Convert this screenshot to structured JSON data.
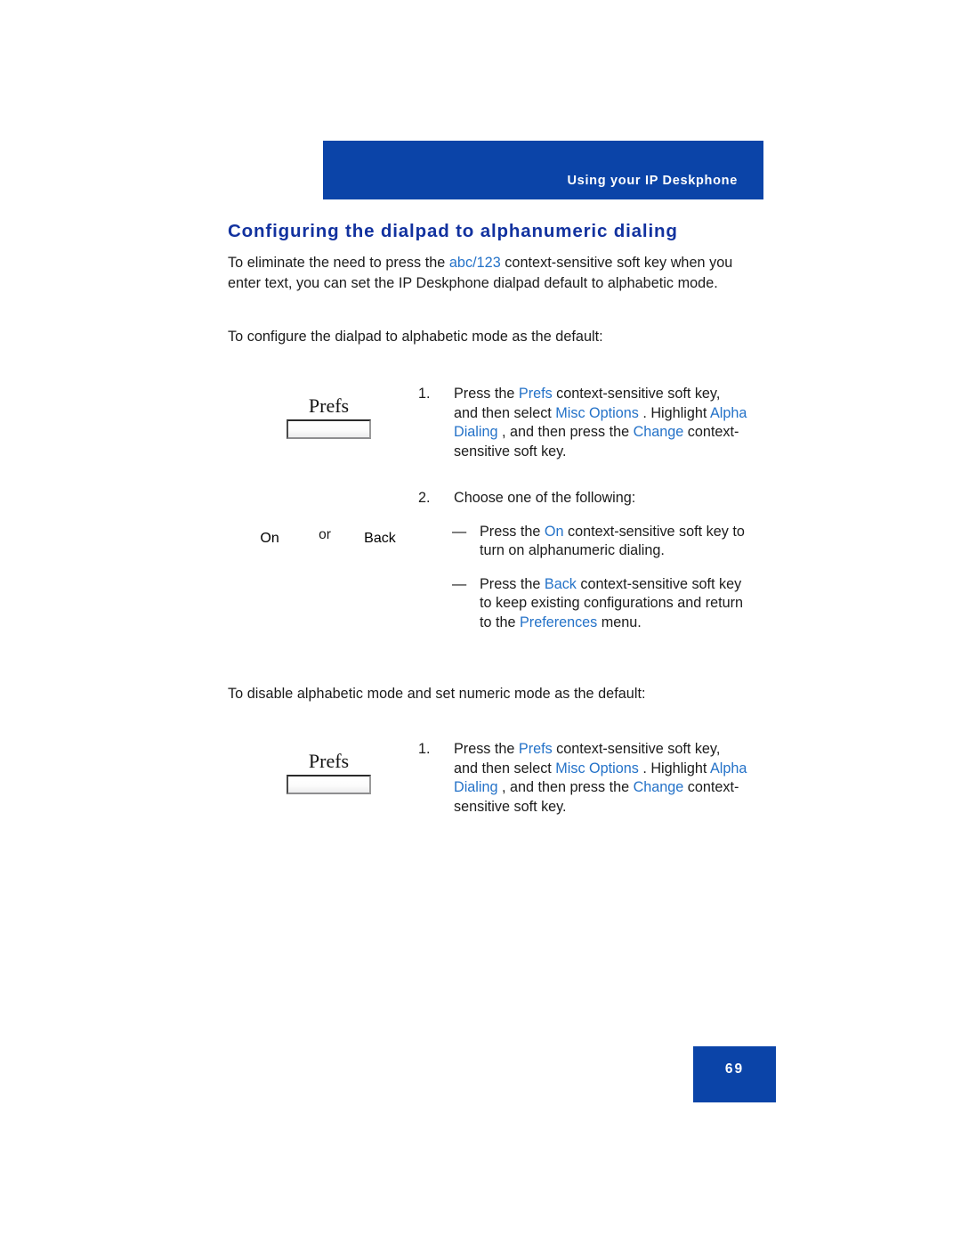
{
  "header": {
    "running_title": "Using your IP Deskphone"
  },
  "section": {
    "title": "Configuring the dialpad to alphanumeric dialing"
  },
  "intro": {
    "part1": "To eliminate the need to press the ",
    "link1": "abc/123",
    "part2": " context-sensitive soft key when you enter text, you can set the IP Deskphone dialpad default to alphabetic mode."
  },
  "procedure_enable": {
    "lead": "To configure the dialpad to alphabetic mode as the default:",
    "step1": {
      "marker": "1.",
      "t1": "Press the ",
      "l1": "Prefs",
      "t2": " context-sensitive soft key, and then select ",
      "l2": "Misc Options",
      "t3": " . Highlight ",
      "l3": "Alpha Dialing",
      "t4": " , and then press the ",
      "l4": "Change",
      "t5": " context-sensitive soft key."
    },
    "step2": {
      "marker": "2.",
      "text": "Choose one of the following:",
      "bullet1": {
        "marker": "—",
        "t1": "Press the ",
        "l1": "On",
        "t2": " context-sensitive soft key to turn on alphanumeric dialing."
      },
      "bullet2": {
        "marker": "—",
        "t1": "Press the ",
        "l1": "Back",
        "t2": " context-sensitive soft key to keep existing configurations and return to the ",
        "l2": "Preferences",
        "t3": " menu."
      }
    }
  },
  "procedure_disable": {
    "lead": "To disable alphabetic mode and set numeric mode as the default:",
    "step1": {
      "marker": "1.",
      "t1": "Press the ",
      "l1": "Prefs",
      "t2": " context-sensitive soft key, and then select ",
      "l2": "Misc Options",
      "t3": " . Highlight ",
      "l3": "Alpha Dialing",
      "t4": " , and then press the ",
      "l4": "Change",
      "t5": " context-sensitive soft key."
    }
  },
  "softkeys": {
    "prefs_top": "Prefs",
    "prefs_bottom": "Prefs",
    "on": "On",
    "back": "Back",
    "or": "or"
  },
  "footer": {
    "page_number": "69"
  },
  "colors": {
    "brand_blue": "#0b44a8",
    "heading_blue": "#12329f",
    "link_blue": "#2472c8",
    "body_black": "#1b1b1b",
    "page_background": "#ffffff"
  }
}
